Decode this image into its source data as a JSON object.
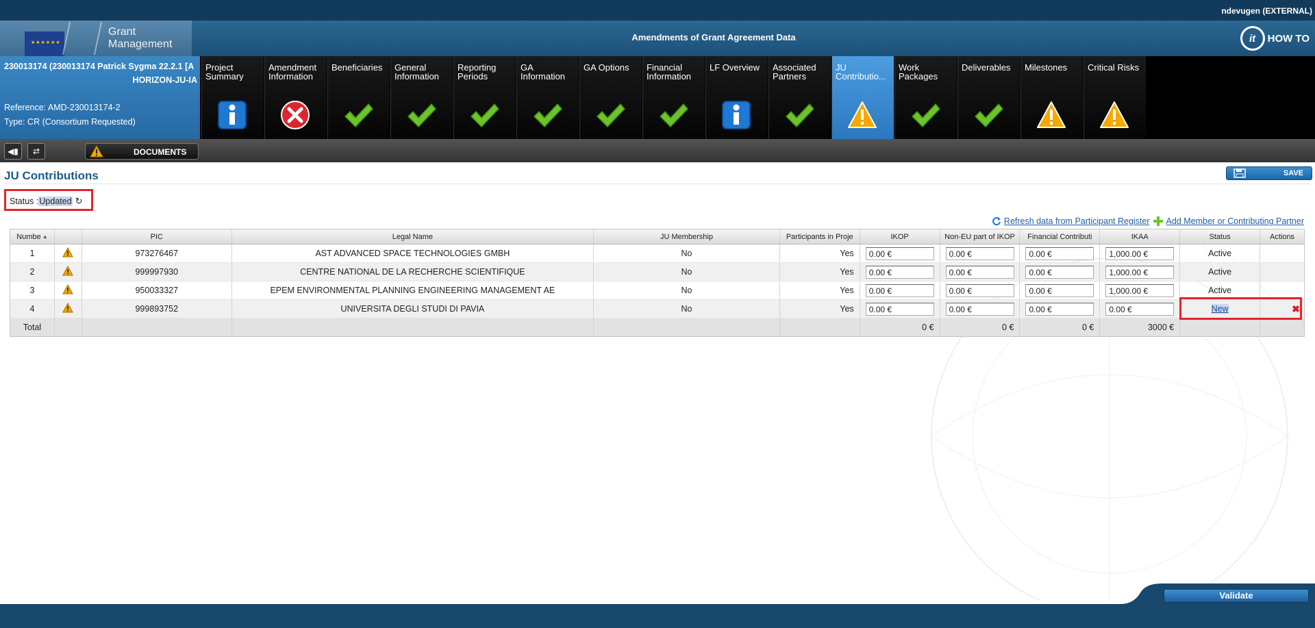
{
  "user": "ndevugen (EXTERNAL)",
  "header": {
    "brand_line1": "Grant",
    "brand_line2": "Management",
    "title": "Amendments of Grant Agreement Data",
    "howto": "HOW TO"
  },
  "project": {
    "line1": "230013174 (230013174 Patrick Sygma 22.2.1 [A",
    "line2": "HORIZON-JU-IA",
    "reference": "Reference: AMD-230013174-2",
    "type": "Type: CR (Consortium Requested)"
  },
  "tabs": [
    {
      "label": "Project\nSummary",
      "icon": "info",
      "active": false
    },
    {
      "label": "Amendment\nInformation",
      "icon": "error",
      "active": false
    },
    {
      "label": "Beneficiaries",
      "icon": "check",
      "active": false
    },
    {
      "label": "General\nInformation",
      "icon": "check",
      "active": false
    },
    {
      "label": "Reporting\nPeriods",
      "icon": "check",
      "active": false
    },
    {
      "label": "GA\nInformation",
      "icon": "check",
      "active": false
    },
    {
      "label": "GA Options",
      "icon": "check",
      "active": false
    },
    {
      "label": "Financial\nInformation",
      "icon": "check",
      "active": false
    },
    {
      "label": "LF Overview",
      "icon": "info",
      "active": false
    },
    {
      "label": "Associated\nPartners",
      "icon": "check",
      "active": false
    },
    {
      "label": "JU\nContributio...",
      "icon": "warning",
      "active": true
    },
    {
      "label": "Work\nPackages",
      "icon": "check",
      "active": false
    },
    {
      "label": "Deliverables",
      "icon": "check",
      "active": false
    },
    {
      "label": "Milestones",
      "icon": "warning",
      "active": false
    },
    {
      "label": "Critical Risks",
      "icon": "warning",
      "active": false
    }
  ],
  "toolbar": {
    "documents": "DOCUMENTS"
  },
  "page": {
    "title": "JU Contributions",
    "save": "SAVE",
    "status_label": "Status :",
    "status_value": "Updated",
    "refresh_link": "Refresh data from Participant Register",
    "add_link": "Add Member or Contributing Partner"
  },
  "table": {
    "headers": {
      "number": "Numbe",
      "pic": "PIC",
      "legal_name": "Legal Name",
      "ju_membership": "JU Membership",
      "participates": "Participants in Proje",
      "ikop": "IKOP",
      "non_eu_ikop": "Non-EU part of IKOP",
      "financial": "Financial Contributi",
      "ikaa": "IKAA",
      "status": "Status",
      "actions": "Actions"
    },
    "rows": [
      {
        "num": "1",
        "pic": "973276467",
        "name": "AST ADVANCED SPACE TECHNOLOGIES GMBH",
        "member": "No",
        "part": "Yes",
        "ikop": "0.00 €",
        "noneu": "0.00 €",
        "fin": "0.00 €",
        "ikaa": "1,000.00 €",
        "status": "Active"
      },
      {
        "num": "2",
        "pic": "999997930",
        "name": "CENTRE NATIONAL DE LA RECHERCHE SCIENTIFIQUE",
        "member": "No",
        "part": "Yes",
        "ikop": "0.00 €",
        "noneu": "0.00 €",
        "fin": "0.00 €",
        "ikaa": "1,000.00 €",
        "status": "Active"
      },
      {
        "num": "3",
        "pic": "950033327",
        "name": "EPEM ENVIRONMENTAL PLANNING ENGINEERING MANAGEMENT AE",
        "member": "No",
        "part": "Yes",
        "ikop": "0.00 €",
        "noneu": "0.00 €",
        "fin": "0.00 €",
        "ikaa": "1,000.00 €",
        "status": "Active"
      },
      {
        "num": "4",
        "pic": "999893752",
        "name": "UNIVERSITA DEGLI STUDI DI PAVIA",
        "member": "No",
        "part": "Yes",
        "ikop": "0.00 €",
        "noneu": "0.00 €",
        "fin": "0.00 €",
        "ikaa": "0.00 €",
        "status": "New",
        "action": "✖"
      }
    ],
    "total": {
      "label": "Total",
      "ikop": "0 €",
      "noneu": "0 €",
      "fin": "0 €",
      "ikaa": "3000 €"
    }
  },
  "footer": {
    "validate": "Validate"
  },
  "colors": {
    "accent": "#1f5a88",
    "highlight_border": "#e3242b",
    "check_green": "#6cc32a",
    "warning_yellow": "#f5a800",
    "error_red": "#d9272e",
    "info_blue": "#1f78d1"
  }
}
